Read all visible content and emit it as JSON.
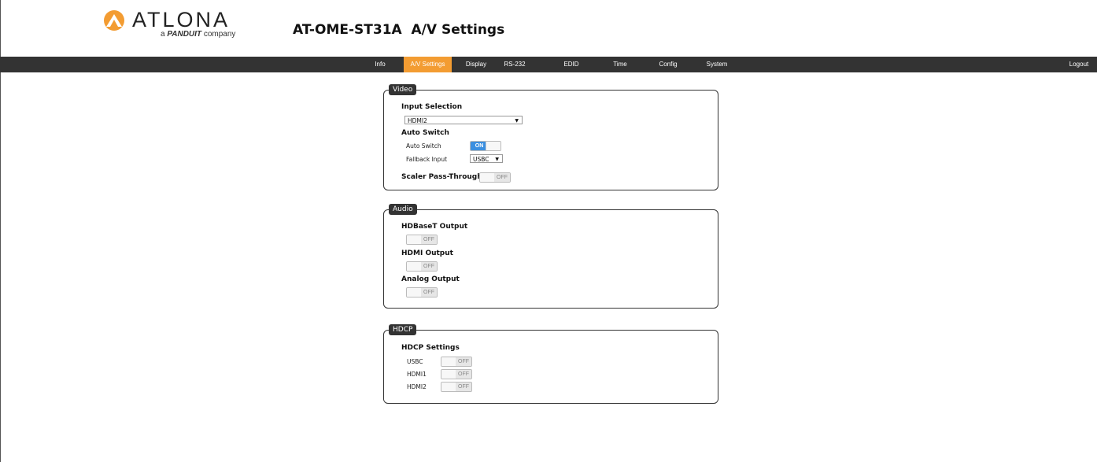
{
  "header": {
    "logo_text": "ATLONA",
    "logo_sub_prefix": "a",
    "logo_sub_brand": "PANDUIT",
    "logo_sub_suffix": "company",
    "title": "AT-OME-ST31A  A/V Settings"
  },
  "nav": {
    "items": [
      "Info",
      "A/V Settings",
      "Display",
      "RS-232",
      "EDID",
      "Time",
      "Config",
      "System"
    ],
    "active": "A/V Settings",
    "logout": "Logout",
    "active_color": "#f39c32"
  },
  "video": {
    "legend": "Video",
    "input_selection_label": "Input Selection",
    "input_selection_value": "HDMI2",
    "auto_switch_heading": "Auto Switch",
    "auto_switch_label": "Auto Switch",
    "auto_switch_state": "ON",
    "fallback_label": "Fallback Input",
    "fallback_value": "USBC",
    "scaler_label": "Scaler Pass-Through",
    "scaler_state": "OFF"
  },
  "audio": {
    "legend": "Audio",
    "hdbaset_label": "HDBaseT Output",
    "hdbaset_state": "OFF",
    "hdmi_label": "HDMI Output",
    "hdmi_state": "OFF",
    "analog_label": "Analog Output",
    "analog_state": "OFF"
  },
  "hdcp": {
    "legend": "HDCP",
    "settings_label": "HDCP Settings",
    "rows": [
      {
        "label": "USBC",
        "state": "OFF"
      },
      {
        "label": "HDMI1",
        "state": "OFF"
      },
      {
        "label": "HDMI2",
        "state": "OFF"
      }
    ]
  }
}
